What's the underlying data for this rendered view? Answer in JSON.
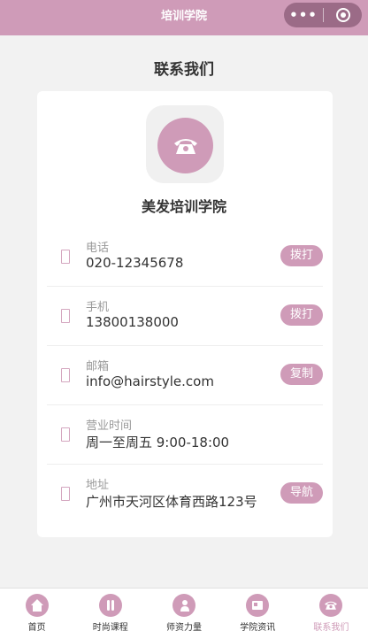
{
  "app": {
    "title": "培训学院"
  },
  "page": {
    "title": "联系我们"
  },
  "org": {
    "name": "美发培训学院"
  },
  "contacts": [
    {
      "label": "电话",
      "value": "020-12345678",
      "action": "拨打"
    },
    {
      "label": "手机",
      "value": "13800138000",
      "action": "拨打"
    },
    {
      "label": "邮箱",
      "value": "info@hairstyle.com",
      "action": "复制"
    },
    {
      "label": "营业时间",
      "value": "周一至周五 9:00-18:00",
      "action": ""
    },
    {
      "label": "地址",
      "value": "广州市天河区体育西路123号",
      "action": "导航"
    }
  ],
  "tabs": [
    {
      "label": "首页",
      "icon": "home-icon"
    },
    {
      "label": "时尚课程",
      "icon": "scissors-icon"
    },
    {
      "label": "师资力量",
      "icon": "teacher-icon"
    },
    {
      "label": "学院资讯",
      "icon": "news-icon"
    },
    {
      "label": "联系我们",
      "icon": "phone-icon",
      "active": true
    }
  ],
  "colors": {
    "accent": "#cf9bb8",
    "background": "#f2f2f2"
  }
}
